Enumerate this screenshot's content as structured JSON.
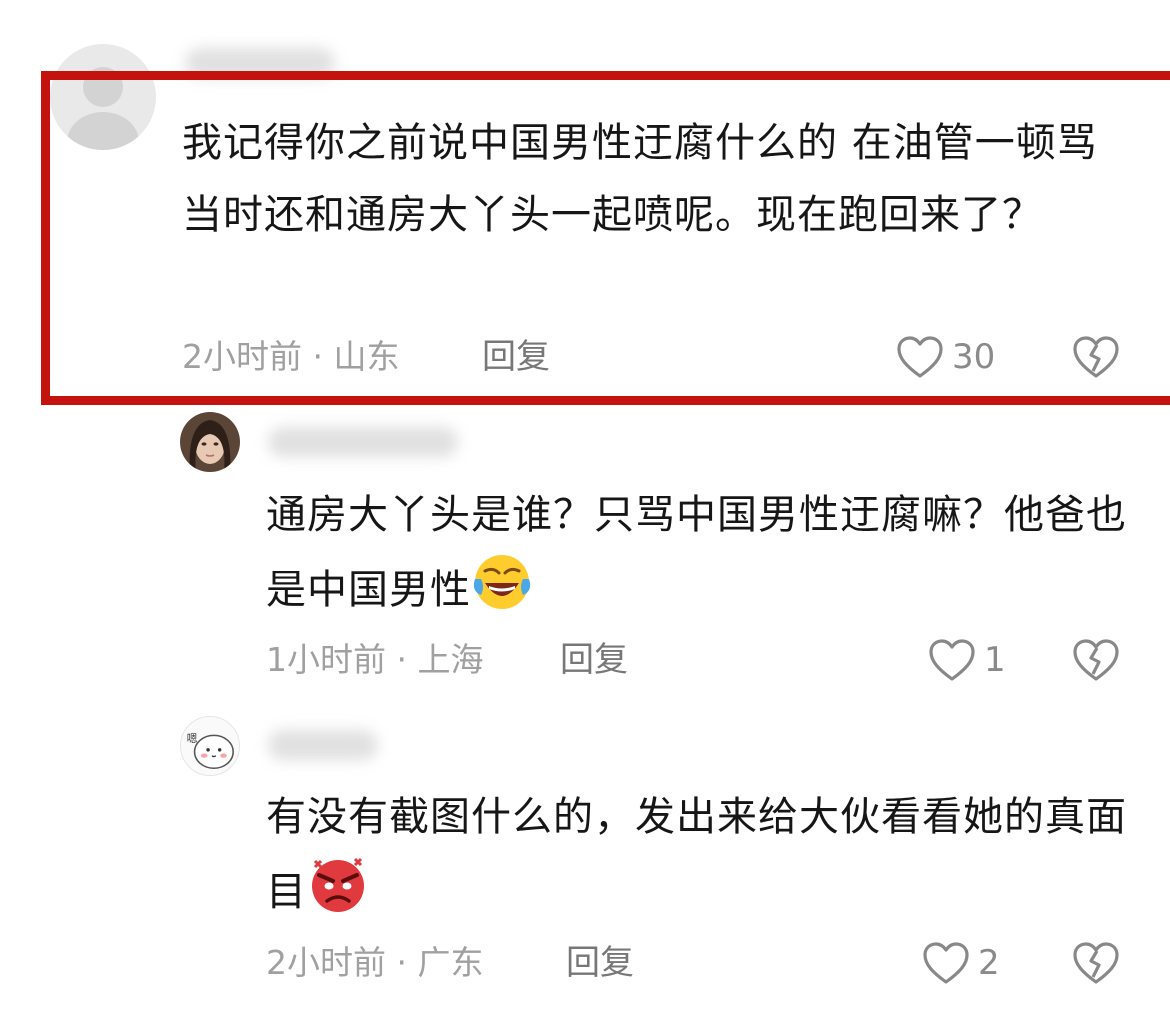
{
  "comments": [
    {
      "text": "我记得你之前说中国男性迂腐什么的 在油管一顿骂 当时还和通房大丫头一起喷呢。现在跑回来了？",
      "time_location": "2小时前 · 山东",
      "reply_label": "回复",
      "likes": "30"
    },
    {
      "text": "通房大丫头是谁？只骂中国男性迂腐嘛？他爸也是中国男性",
      "time_location": "1小时前 · 上海",
      "reply_label": "回复",
      "likes": "1"
    },
    {
      "text": "有没有截图什么的，发出来给大伙看看她的真面目",
      "time_location": "2小时前 · 广东",
      "reply_label": "回复",
      "likes": "2"
    }
  ],
  "avatar3_text": "嗯",
  "colors": {
    "highlight": "#c4130f",
    "meta": "#a0a0a0",
    "reply": "#777777"
  },
  "icons": [
    "heart-icon",
    "broken-heart-icon",
    "laughing-crying-emoji",
    "angry-face-emoji"
  ]
}
